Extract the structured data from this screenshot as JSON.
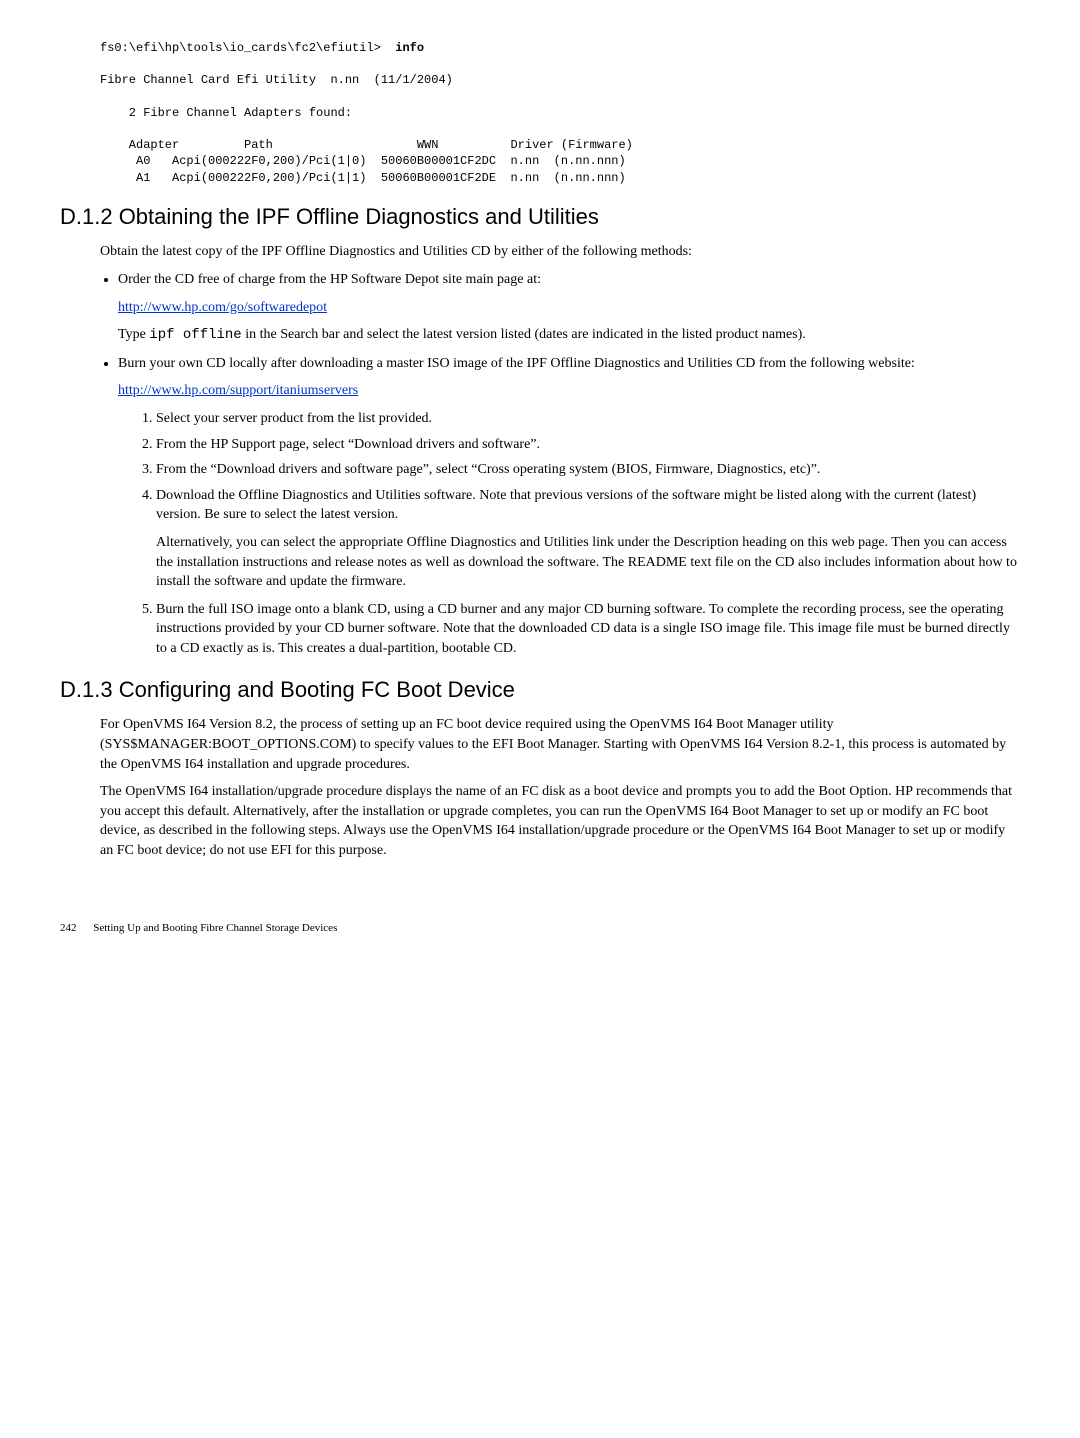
{
  "code1": {
    "line1_prompt": "fs0:\\efi\\hp\\tools\\io_cards\\fc2\\efiutil>  ",
    "line1_cmd": "info",
    "line2": "Fibre Channel Card Efi Utility  n.nn  (11/1/2004)",
    "line3": "    2 Fibre Channel Adapters found:",
    "line4": "    Adapter         Path                    WWN          Driver (Firmware)",
    "line5": "     A0   Acpi(000222F0,200)/Pci(1|0)  50060B00001CF2DC  n.nn  (n.nn.nnn)",
    "line6": "     A1   Acpi(000222F0,200)/Pci(1|1)  50060B00001CF2DE  n.nn  (n.nn.nnn)"
  },
  "section_d12": {
    "heading": "D.1.2  Obtaining the IPF Offline Diagnostics and Utilities",
    "intro": "Obtain the latest copy of the IPF Offline Diagnostics and Utilities CD by either of the following methods:",
    "bullet1_text": "Order the CD free of charge from the HP Software Depot site main page at:",
    "bullet1_link": "http://www.hp.com/go/softwaredepot",
    "bullet1_para2a": "Type ",
    "bullet1_para2_code": "ipf offline",
    "bullet1_para2b": " in the Search bar and select the latest version listed (dates are indicated in the listed product names).",
    "bullet2_text": "Burn your own CD locally after downloading a master ISO image of the IPF Offline Diagnostics and Utilities CD from the following website:",
    "bullet2_link": "http://www.hp.com/support/itaniumservers",
    "numlist": {
      "n1": "Select your server product from the list provided.",
      "n2": "From the HP Support page, select “Download drivers and software”.",
      "n3": "From the “Download drivers and software page”, select “Cross operating system (BIOS, Firmware, Diagnostics, etc)”.",
      "n4": "Download the Offline Diagnostics and Utilities software. Note that previous versions of the software might be listed along with the current (latest) version. Be sure to select the latest version.",
      "n4_p2": "Alternatively, you can select the appropriate Offline Diagnostics and Utilities link under the Description heading on this web page. Then you can access the installation instructions and release notes as well as download the software. The README text file on the CD also includes information about how to install the software and update the firmware.",
      "n5": "Burn the full ISO image onto a blank CD, using a CD burner and any major CD burning software. To complete the recording process, see the operating instructions provided by your CD burner software. Note that the downloaded CD data is a single ISO image file. This image file must be burned directly to a CD exactly as is. This creates a dual-partition, bootable CD."
    }
  },
  "section_d13": {
    "heading": "D.1.3  Configuring and Booting FC Boot Device",
    "p1": "For OpenVMS I64 Version 8.2, the process of setting up an FC boot device required using the OpenVMS I64 Boot Manager utility (SYS$MANAGER:BOOT_OPTIONS.COM) to specify values to the EFI Boot Manager. Starting with OpenVMS I64 Version 8.2-1, this process is automated by the OpenVMS I64 installation and upgrade procedures.",
    "p2": "The OpenVMS I64 installation/upgrade procedure displays the name of an FC disk as a boot device and prompts you to add the Boot Option. HP recommends that you accept this default. Alternatively, after the installation or upgrade completes, you can run the OpenVMS I64 Boot Manager to set up or modify an FC boot device, as described in the following steps. Always use the OpenVMS I64 installation/upgrade procedure or the OpenVMS I64 Boot Manager to set up or modify an FC boot device; do not use EFI for this purpose."
  },
  "footer": {
    "page": "242",
    "title": "Setting Up and Booting Fibre Channel Storage Devices"
  }
}
